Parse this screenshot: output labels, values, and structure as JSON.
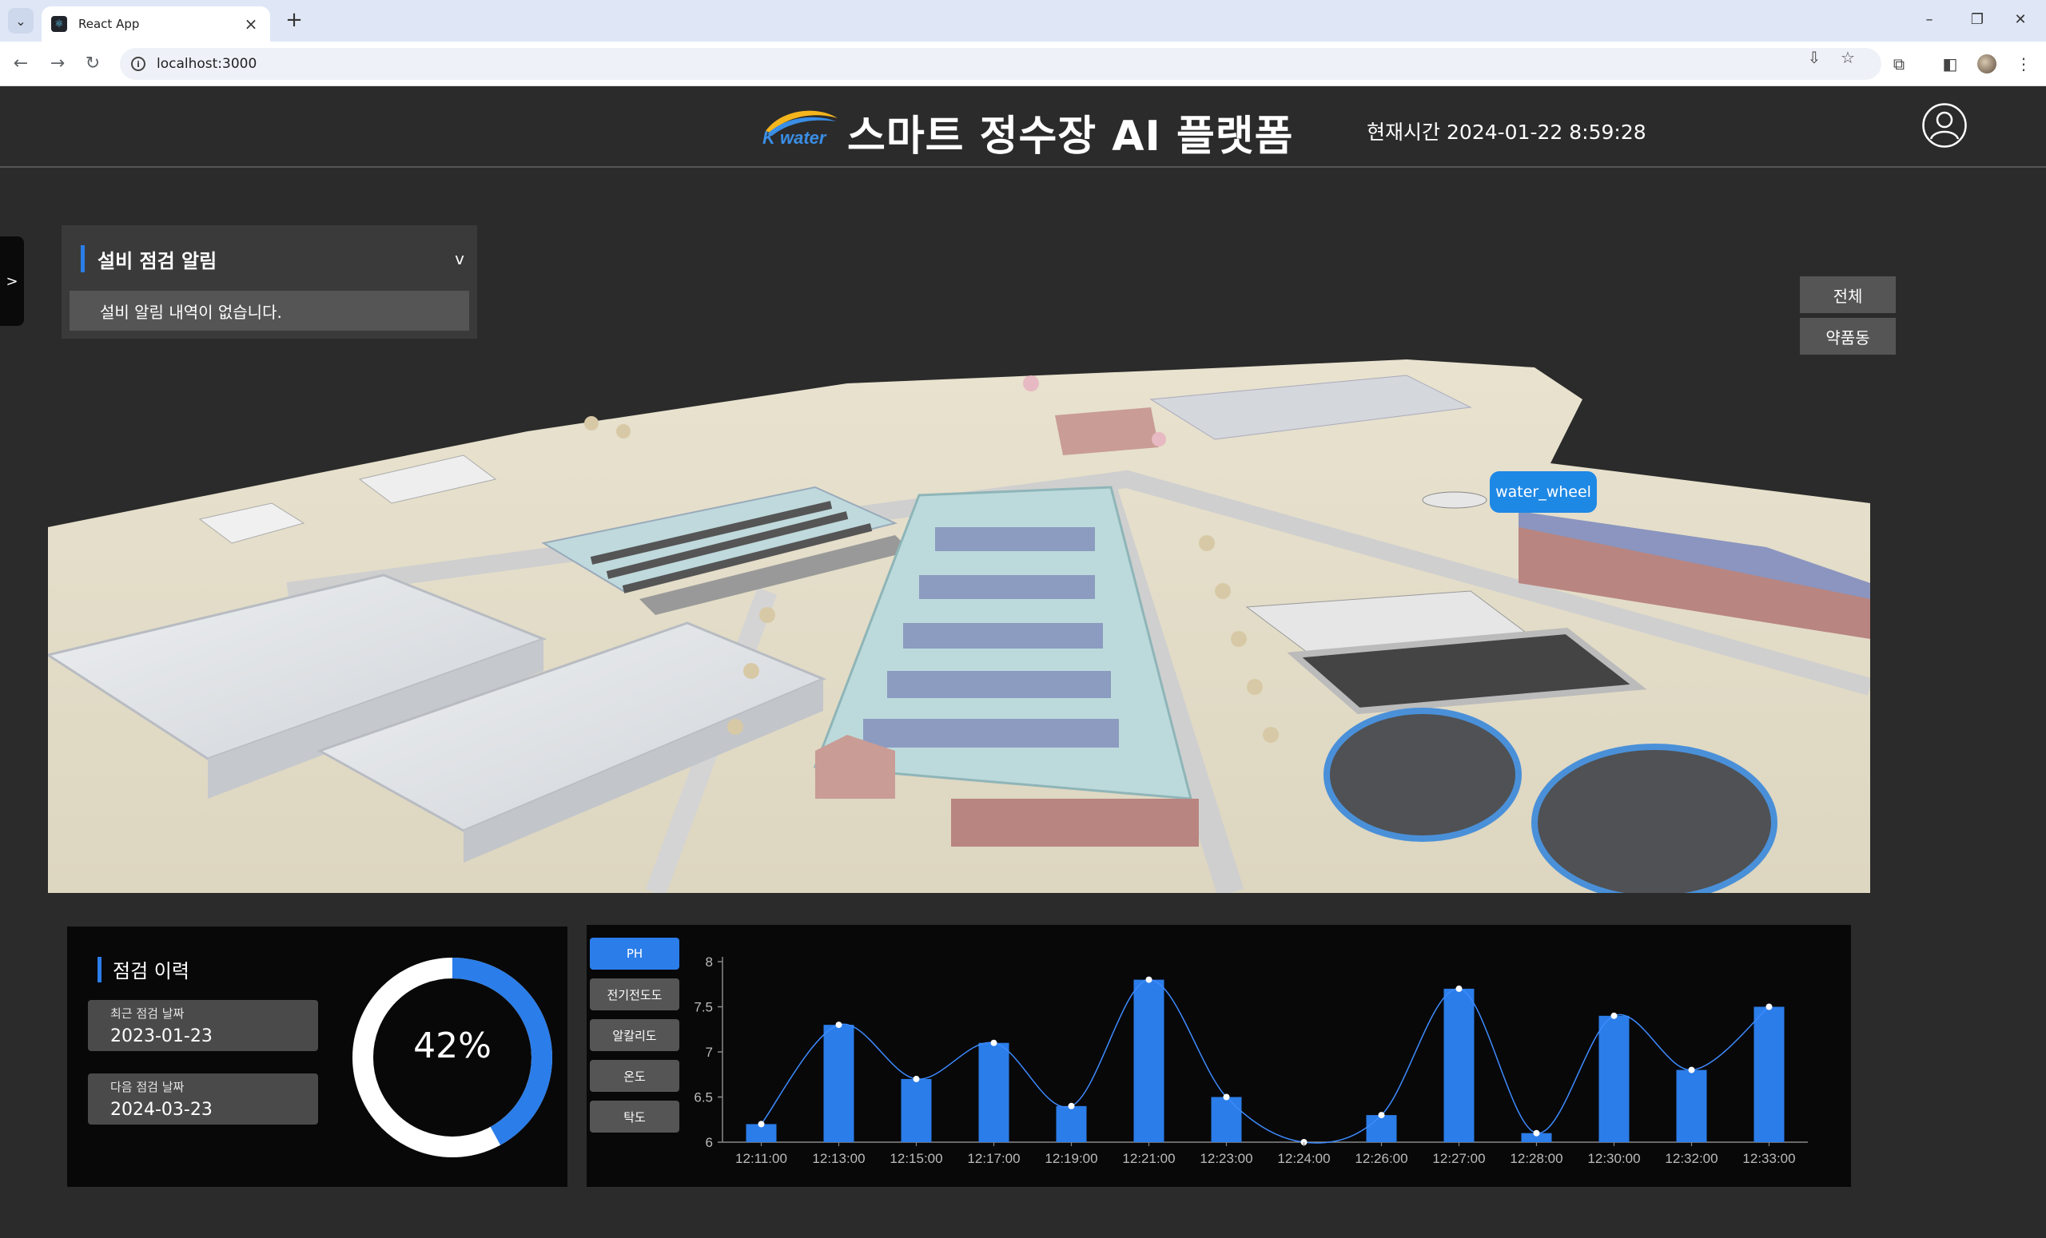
{
  "browser": {
    "tab_title": "React App",
    "url": "localhost:3000"
  },
  "header": {
    "logo_text": "K water",
    "title": "스마트 정수장 AI 플랫폼",
    "clock_label": "현재시간",
    "clock_value": "2024-01-22 8:59:28"
  },
  "sidebar_toggle": ">",
  "alert_panel": {
    "title": "설비 점검 알림",
    "toggle": "v",
    "empty_message": "설비 알림 내역이 없습니다."
  },
  "view_buttons": [
    "전체",
    "약품동"
  ],
  "scene": {
    "tooltip": "water_wheel"
  },
  "history": {
    "title": "점검 이력",
    "last_label": "최근 점검 날짜",
    "last_date": "2023-01-23",
    "next_label": "다음 점검 날짜",
    "next_date": "2024-03-23",
    "progress_text": "42%",
    "progress": 0.42
  },
  "metrics": {
    "buttons": [
      "PH",
      "전기전도도",
      "알칼리도",
      "온도",
      "탁도"
    ],
    "active": "PH"
  },
  "colors": {
    "accent": "#2b7de9",
    "tooltip": "#1e88e5",
    "panel": "#080808",
    "background": "#2b2b2b"
  },
  "chart_data": {
    "type": "bar",
    "categories": [
      "12:11:00",
      "12:13:00",
      "12:15:00",
      "12:17:00",
      "12:19:00",
      "12:21:00",
      "12:23:00",
      "12:24:00",
      "12:26:00",
      "12:27:00",
      "12:28:00",
      "12:30:00",
      "12:32:00",
      "12:33:00"
    ],
    "values": [
      6.2,
      7.3,
      6.7,
      7.1,
      6.4,
      7.8,
      6.5,
      6.0,
      6.3,
      7.7,
      6.1,
      7.4,
      6.8,
      7.5
    ],
    "ylim": [
      6,
      8
    ],
    "yticks": [
      "6",
      "6.5",
      "7",
      "7.5",
      "8"
    ],
    "overlay": "smooth line through bar tops with point markers",
    "grid": false
  }
}
